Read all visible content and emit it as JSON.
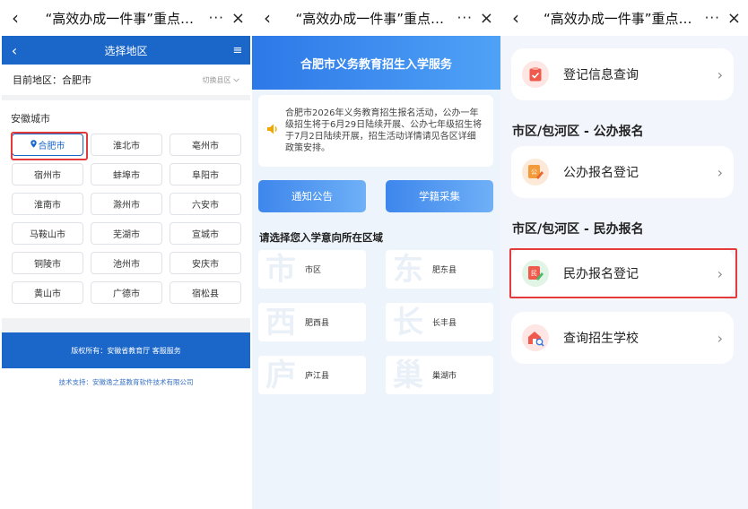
{
  "wechat": {
    "back_icon": "‹",
    "title": "“高效办成一件事”重点…",
    "more_icon": "···",
    "close_icon": "×"
  },
  "panel1": {
    "header": {
      "back_icon": "‹",
      "title": "选择地区",
      "menu_icon": "≡"
    },
    "current_region_label": "目前地区：合肥市",
    "switch_label": "切换县区",
    "switch_icon": "chevron-down-icon",
    "province_label": "安徽城市",
    "cities": [
      "合肥市",
      "淮北市",
      "亳州市",
      "宿州市",
      "蚌埠市",
      "阜阳市",
      "淮南市",
      "滁州市",
      "六安市",
      "马鞍山市",
      "芜湖市",
      "宣城市",
      "铜陵市",
      "池州市",
      "安庆市",
      "黄山市",
      "广德市",
      "宿松县"
    ],
    "selected_city_index": 0,
    "footer_text": "版权所有：安徽省教育厅 客服服务",
    "tech_support": "技术支持：安徽逸之蓝教育软件技术有限公司"
  },
  "panel2": {
    "banner_title": "合肥市义务教育招生入学服务",
    "notice_icon": "speaker-icon",
    "notice_text": "合肥市2026年义务教育招生报名活动，公办一年级招生将于6月29日陆续开展、公办七年级招生将于7月2日陆续开展，招生活动详情请见各区详细政策安排。",
    "buttons": {
      "notice": "通知公告",
      "student_status": "学籍采集"
    },
    "section_title": "请选择您入学意向所在区域",
    "districts": [
      {
        "watermark": "市",
        "name": "市区"
      },
      {
        "watermark": "东",
        "name": "肥东县"
      },
      {
        "watermark": "西",
        "name": "肥西县"
      },
      {
        "watermark": "长",
        "name": "长丰县"
      },
      {
        "watermark": "庐",
        "name": "庐江县"
      },
      {
        "watermark": "巢",
        "name": "巢湖市"
      }
    ]
  },
  "panel3": {
    "query_info": "登记信息查询",
    "public_section": "市区/包河区 - 公办报名",
    "public_register": "公办报名登记",
    "private_section": "市区/包河区 - 民办报名",
    "private_register": "民办报名登记",
    "query_school": "查询招生学校",
    "chevron": "›",
    "icon_public_label": "公",
    "icon_private_label": "民"
  },
  "colors": {
    "primary_blue": "#1b67c9",
    "highlight_red": "#e33b3b",
    "icon_red": "#ef5a4c",
    "icon_orange": "#f39a3a",
    "icon_green": "#4cb86a"
  }
}
